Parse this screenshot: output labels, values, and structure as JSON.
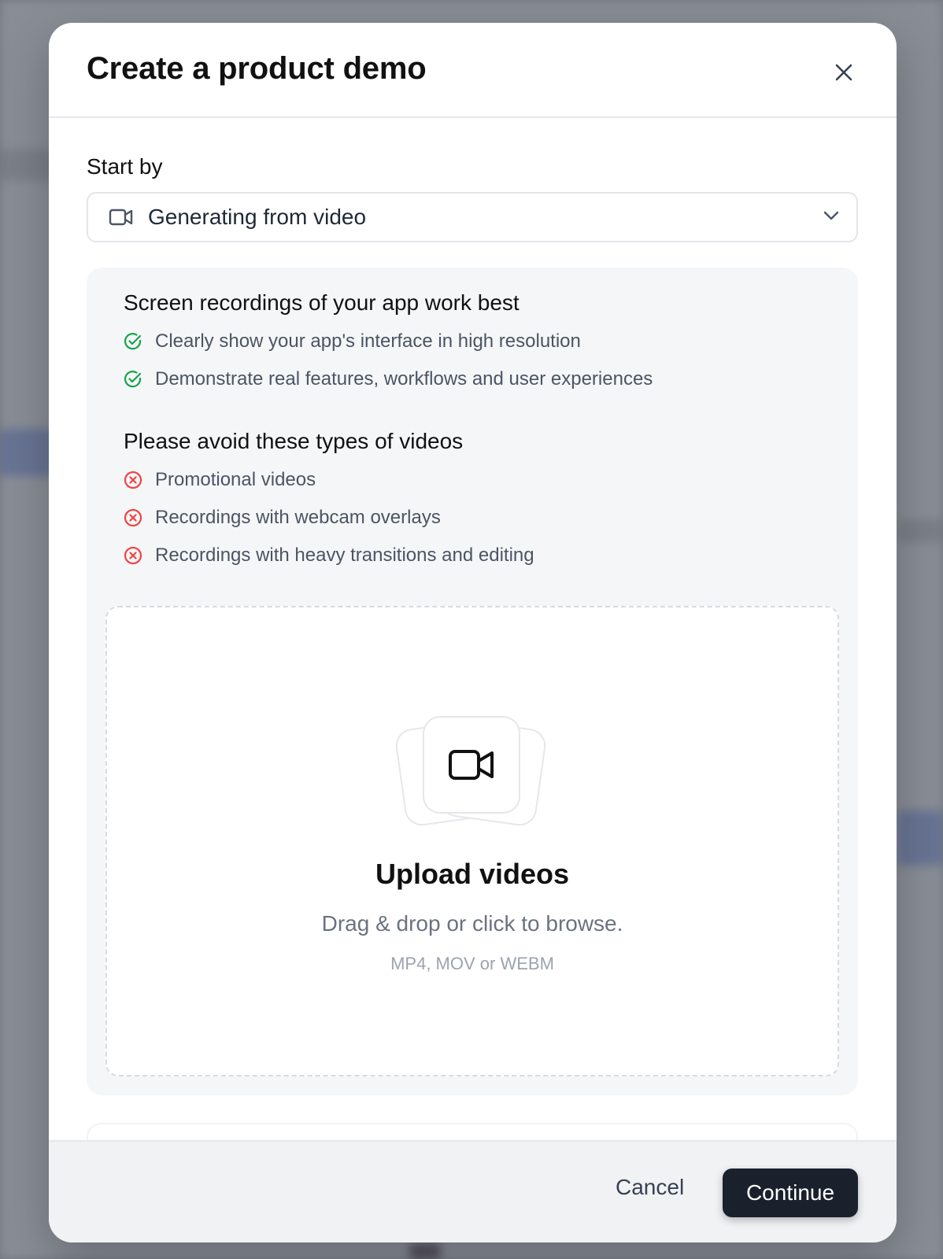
{
  "modal": {
    "title": "Create a product demo"
  },
  "form": {
    "start_label": "Start by",
    "start_value": "Generating from video"
  },
  "guidelines": {
    "good_title": "Screen recordings of your app work best",
    "good_items": [
      "Clearly show your app's interface in high resolution",
      "Demonstrate real features, workflows and user experiences"
    ],
    "bad_title": "Please avoid these types of videos",
    "bad_items": [
      "Promotional videos",
      "Recordings with webcam overlays",
      "Recordings with heavy transitions and editing"
    ]
  },
  "upload": {
    "title": "Upload videos",
    "subtitle": "Drag & drop or click to browse.",
    "formats": "MP4, MOV or WEBM"
  },
  "footer": {
    "cancel_label": "Cancel",
    "continue_label": "Continue"
  },
  "colors": {
    "success": "#16a34a",
    "error": "#ef4444",
    "primary_button": "#1a212d"
  },
  "icons": {
    "close": "close-icon",
    "select_leading": "video-camera-icon",
    "select_trailing": "chevron-down-icon",
    "good": "check-circle-icon",
    "bad": "x-circle-icon",
    "upload": "video-camera-icon"
  }
}
